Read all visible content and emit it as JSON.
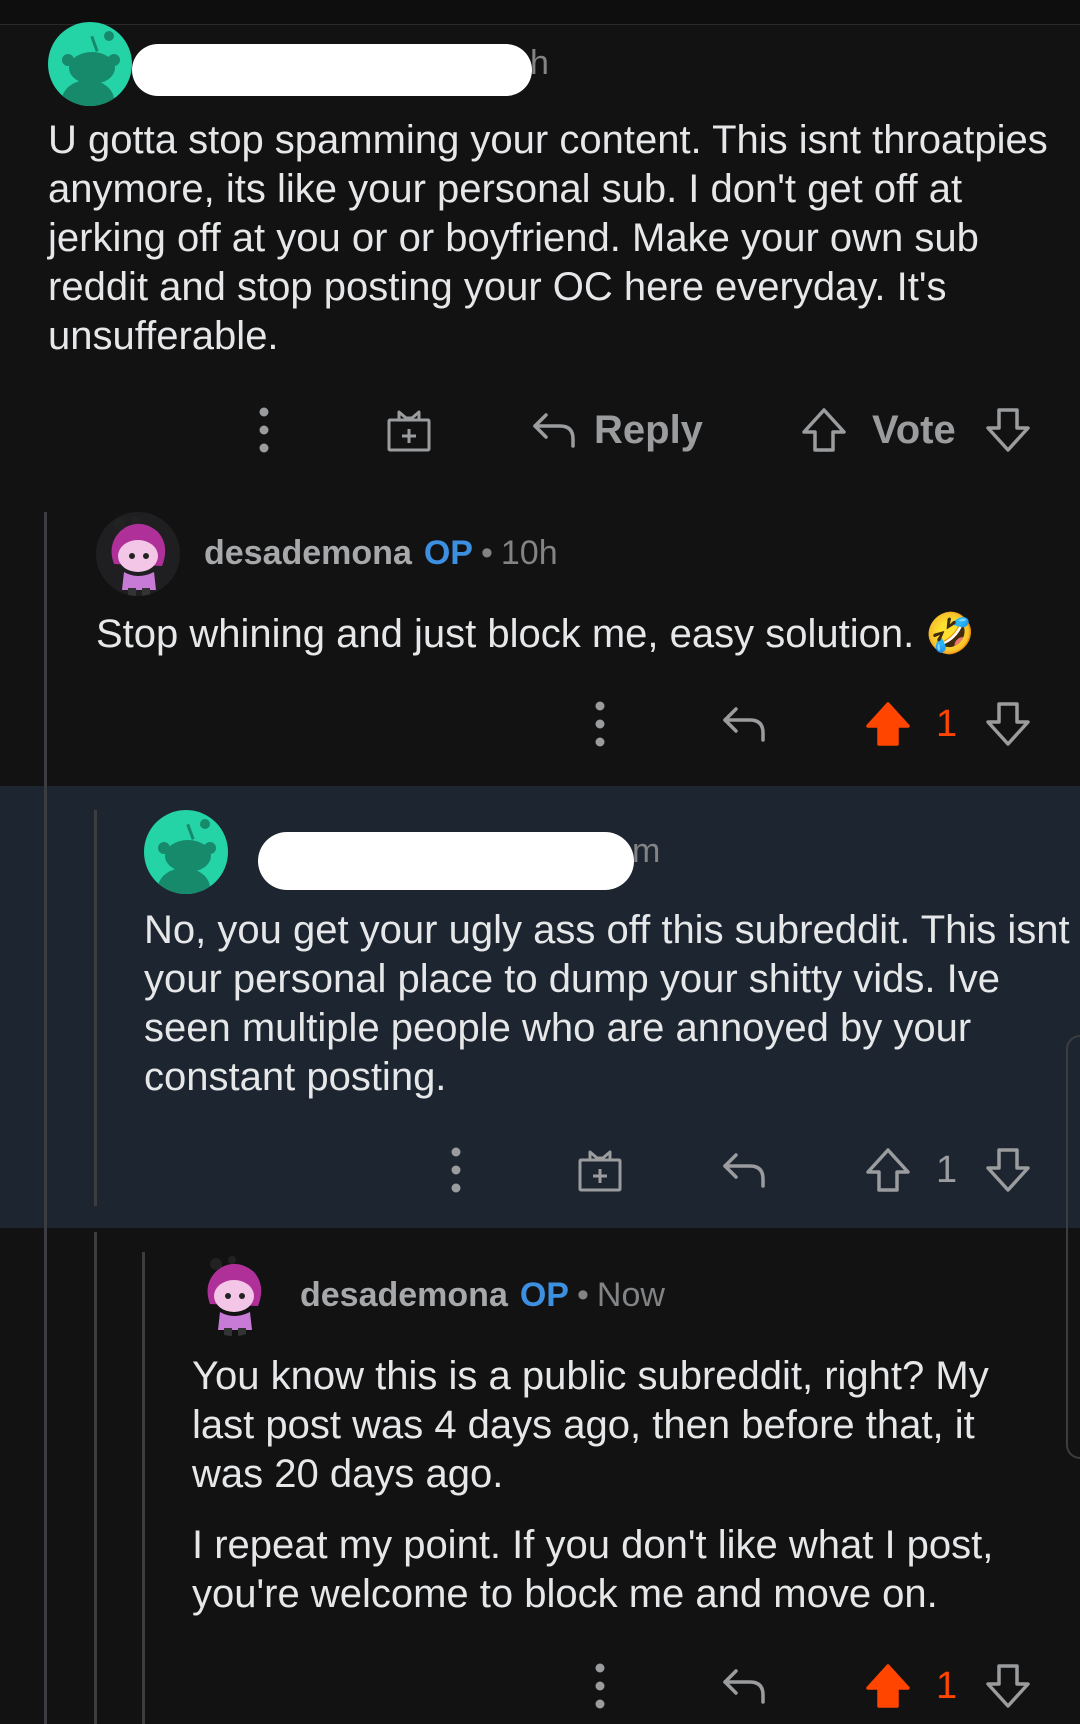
{
  "comments": [
    {
      "time_suffix": "h",
      "body": [
        "U gotta stop spamming your content. This isnt throatpies anymore, its like your personal sub. I don't get off at jerking off at you or or boyfriend. Make your own sub reddit and stop posting your OC here everyday. It's unsufferable."
      ],
      "actions": {
        "reply_label": "Reply",
        "vote_label": "Vote"
      }
    },
    {
      "username": "desademona",
      "op_badge": "OP",
      "separator": "•",
      "time": "10h",
      "body": [
        "Stop whining and just block me, easy solution. 🤣"
      ],
      "actions": {
        "vote_count": "1",
        "upvoted": true
      }
    },
    {
      "time_suffix": "m",
      "body": [
        "No, you get your ugly ass off this subreddit. This isnt your personal place to dump your shitty vids. Ive seen multiple people who are annoyed by your constant posting."
      ],
      "actions": {
        "vote_count": "1",
        "upvoted": false
      }
    },
    {
      "username": "desademona",
      "op_badge": "OP",
      "separator": "•",
      "time": "Now",
      "body": [
        "You know this is a public subreddit, right? My last post was 4 days ago, then before that, it was 20 days ago.",
        "I repeat my point. If you don't like what I post, you're welcome to block me and move on."
      ],
      "actions": {
        "vote_count": "1",
        "upvoted": true
      }
    }
  ],
  "colors": {
    "background": "#121213",
    "highlight": "#1d2530",
    "op_badge": "#3d8fe0",
    "upvote": "#ff4500",
    "snoo_avatar": "#24d3a6"
  },
  "icons": [
    "snoo-avatar-icon",
    "more-options-icon",
    "award-icon",
    "reply-icon",
    "upvote-icon",
    "downvote-icon"
  ]
}
